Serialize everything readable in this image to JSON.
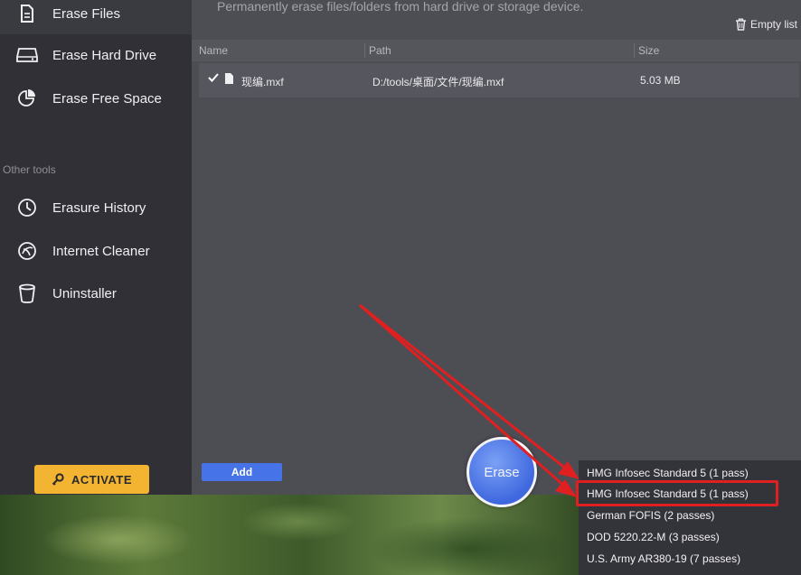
{
  "sidebar": {
    "items": [
      {
        "label": "Erase Files",
        "icon": "file-icon"
      },
      {
        "label": "Erase Hard Drive",
        "icon": "hard-drive-icon"
      },
      {
        "label": "Erase Free Space",
        "icon": "pie-chart-icon"
      }
    ],
    "section_label": "Other tools",
    "tools": [
      {
        "label": "Erasure History",
        "icon": "clock-icon"
      },
      {
        "label": "Internet Cleaner",
        "icon": "browser-icon"
      },
      {
        "label": "Uninstaller",
        "icon": "trash-bin-icon"
      }
    ],
    "activate_label": "ACTIVATE",
    "activate_icon": "key-icon"
  },
  "main": {
    "subtitle": "Permanently erase files/folders from hard drive or storage device.",
    "empty_list_label": "Empty list",
    "columns": [
      "Name",
      "Path",
      "Size"
    ],
    "rows": [
      {
        "checked": true,
        "name": "现编.mxf",
        "path": "D:/tools/桌面/文件/现编.mxf",
        "size": "5.03 MB"
      }
    ],
    "add_label": "Add",
    "erase_label": "Erase"
  },
  "erase_methods": {
    "options": [
      "HMG Infosec Standard 5 (1 pass)",
      "HMG Infosec Standard 5 (1 pass)",
      "German FOFIS (2 passes)",
      "DOD 5220.22-M (3 passes)",
      "U.S. Army AR380-19 (7 passes)"
    ],
    "highlighted_index": 1
  },
  "colors": {
    "accent": "#4673e8",
    "activate": "#f2b431",
    "annotation": "#e02020"
  }
}
